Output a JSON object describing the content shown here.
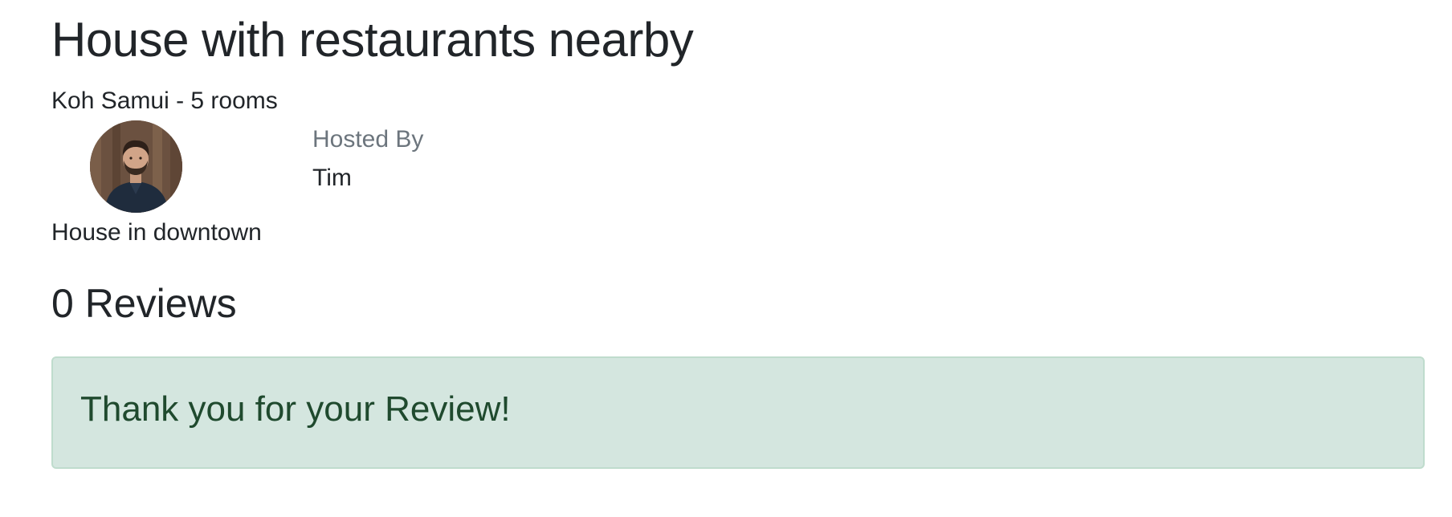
{
  "listing": {
    "title": "House with restaurants nearby",
    "location_line": "Koh Samui - 5 rooms",
    "description": "House in downtown"
  },
  "host": {
    "label": "Hosted By",
    "name": "Tim",
    "avatar_icon": "host-avatar-photo"
  },
  "reviews": {
    "heading": "0 Reviews"
  },
  "alert": {
    "message": "Thank you for your Review!",
    "background_color": "#d4e6df",
    "border_color": "#bfdccd",
    "text_color": "#1f4a2e"
  }
}
